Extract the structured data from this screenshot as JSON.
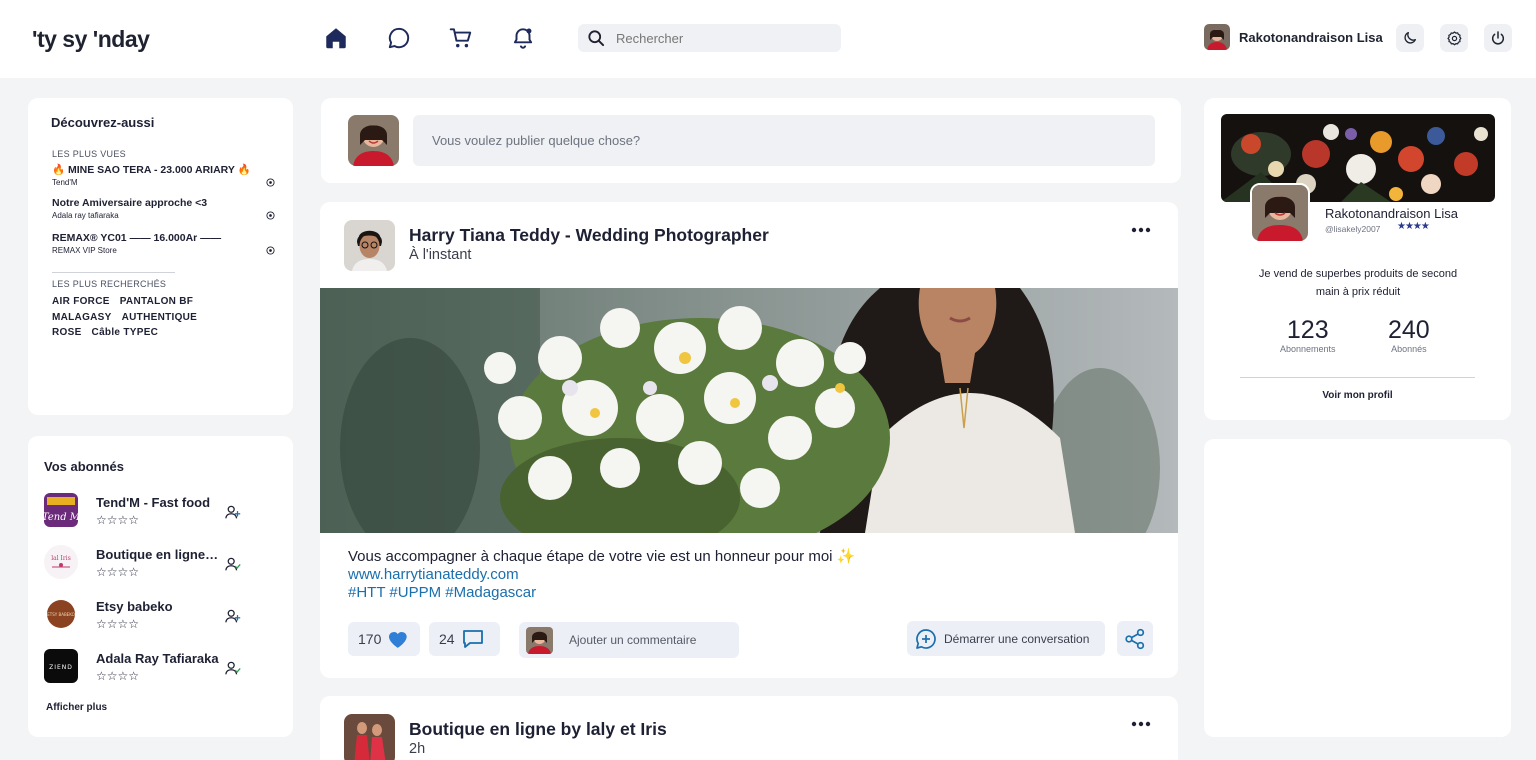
{
  "header": {
    "logo": "'ty sy 'nday",
    "search_placeholder": "Rechercher",
    "user_name": "Rakotonandraison Lisa"
  },
  "discover": {
    "title": "Découvrez-aussi",
    "most_viewed_label": "LES PLUS VUES",
    "items": [
      {
        "title": "🔥 MINE SAO TERA - 23.000 ARIARY 🔥",
        "store": "Tend'M"
      },
      {
        "title": "Notre Amiversaire approche <3",
        "store": "Adala ray tafiaraka"
      },
      {
        "title": "REMAX® YC01 —— 16.000Ar ——",
        "store": "REMAX VIP Store"
      }
    ],
    "most_searched_label": "LES PLUS RECHERCHÉS",
    "tags": [
      "AIR FORCE",
      "PANTALON BF",
      "MALAGASY",
      "AUTHENTIQUE",
      "ROSE",
      "Câble TYPEC"
    ]
  },
  "subscribers": {
    "title": "Vos abonnés",
    "items": [
      {
        "name": "Tend'M - Fast food",
        "stars": "☆☆☆☆",
        "avatar_color": "#6b2a7a",
        "action": "add"
      },
      {
        "name": "Boutique en ligne by laly et Iris",
        "stars": "☆☆☆☆",
        "avatar_color": "#f5eef3",
        "action": "check"
      },
      {
        "name": "Etsy babeko",
        "stars": "☆☆☆☆",
        "avatar_color": "#8a4220",
        "action": "add"
      },
      {
        "name": "Adala Ray Tafiaraka",
        "stars": "☆☆☆☆",
        "avatar_color": "#0b0b0b",
        "action": "check"
      }
    ],
    "more": "Afficher plus"
  },
  "composer": {
    "placeholder": "Vous voulez publier quelque chose?"
  },
  "post": {
    "author": "Harry Tiana Teddy - Wedding Photographer",
    "time": "À l'instant",
    "text": "Vous accompagner à chaque étape de votre vie est un honneur pour moi ✨",
    "link": "www.harrytianateddy.com",
    "hashtags": "#HTT #UPPM #Madagascar",
    "likes": "170",
    "comments": "24",
    "comment_placeholder": "Ajouter un commentaire",
    "conversation_label": "Démarrer une conversation"
  },
  "post2": {
    "author": "Boutique en ligne by laly et Iris",
    "time": "2h"
  },
  "profile": {
    "name": "Rakotonandraison Lisa",
    "handle": "@lisakely2007",
    "stars": "★★★★",
    "bio": "Je vend de superbes produits de second main à prix réduit",
    "following_count": "123",
    "following_label": "Abonnements",
    "followers_count": "240",
    "followers_label": "Abonnés",
    "link": "Voir mon profil"
  },
  "colors": {
    "accent": "#1a6fad",
    "nav_active": "#1f2a5c",
    "heart": "#2f7fd6"
  }
}
